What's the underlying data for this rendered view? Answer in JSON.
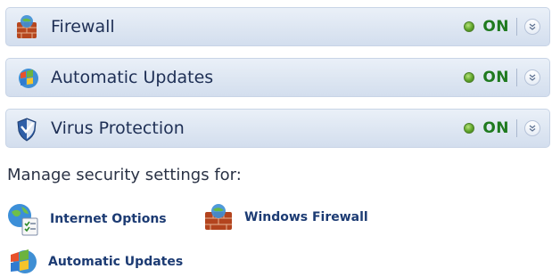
{
  "panels": [
    {
      "title": "Firewall",
      "status": "ON",
      "icon": "firewall-icon"
    },
    {
      "title": "Automatic Updates",
      "status": "ON",
      "icon": "windows-update-icon"
    },
    {
      "title": "Virus Protection",
      "status": "ON",
      "icon": "shield-icon"
    }
  ],
  "manage": {
    "heading": "Manage security settings for:",
    "links": [
      {
        "label": "Internet Options",
        "icon": "internet-options-icon"
      },
      {
        "label": "Windows Firewall",
        "icon": "firewall-icon"
      },
      {
        "label": "Automatic Updates",
        "icon": "windows-update-icon"
      }
    ]
  },
  "colors": {
    "panel_bg": "#dde6f2",
    "panel_title": "#1e2f55",
    "status_on": "#1f7a1f",
    "status_dot": "#5fa52a",
    "link_text": "#1c3b73"
  }
}
